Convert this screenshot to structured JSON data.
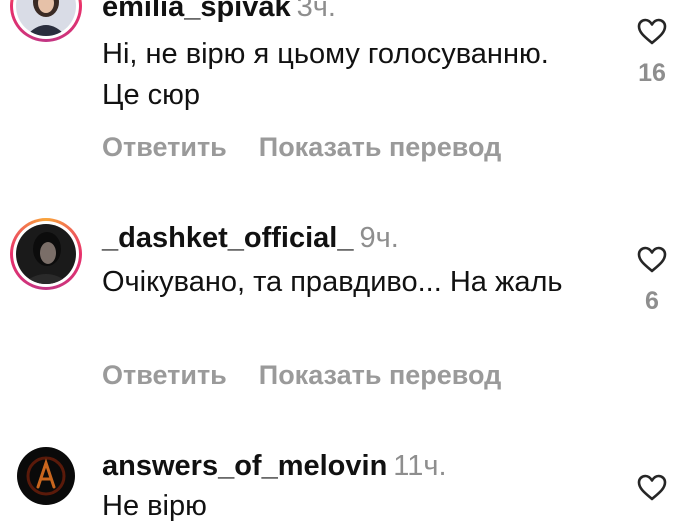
{
  "comments": [
    {
      "username": "emilia_spivak",
      "time": "3ч.",
      "text": "Ні, не вірю я цьому голосуванню. Це сюр",
      "reply_label": "Ответить",
      "translate_label": "Показать перевод",
      "likes": "16",
      "story_ring": true
    },
    {
      "username": "_dashket_official_",
      "time": "9ч.",
      "text": "Очікувано, та правдиво... На жаль",
      "reply_label": "Ответить",
      "translate_label": "Показать перевод",
      "likes": "6",
      "story_ring": true
    },
    {
      "username": "answers_of_melovin",
      "time": "11ч.",
      "text": "Не вірю",
      "likes": "",
      "story_ring": false
    }
  ],
  "icons": {
    "like": "heart-outline-icon"
  },
  "colors": {
    "username": "#111111",
    "meta": "#8e8e8e",
    "actions": "#9a9a9a",
    "ring_start": "#f9a53a",
    "ring_end": "#c13584"
  }
}
